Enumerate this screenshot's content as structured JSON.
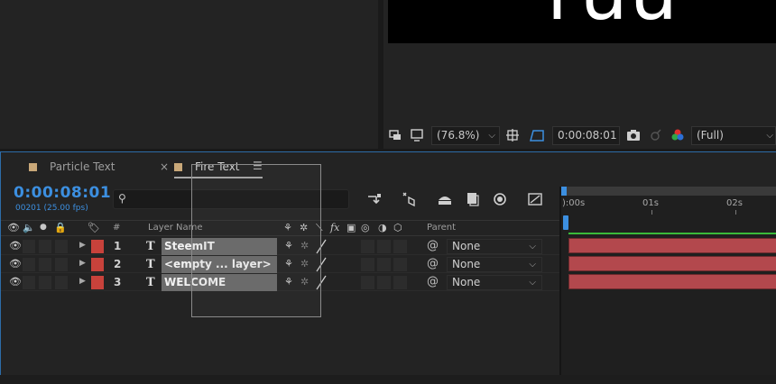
{
  "viewer": {
    "comp_text": "ruu",
    "zoom": "(76.8%)",
    "timecode": "0:00:08:01",
    "resolution": "(Full)",
    "icons": [
      "region-icon",
      "monitor-icon",
      "grid-icon",
      "transparency-grid-icon",
      "snapshot-icon",
      "show-snapshot-icon",
      "channel-icon"
    ]
  },
  "tabs": [
    {
      "label": "Particle Text",
      "active": false
    },
    {
      "label": "Fire Text",
      "active": true
    }
  ],
  "timeline": {
    "timecode": "0:00:08:01",
    "frames_fps": "00201 (25.00 fps)",
    "search_placeholder": "",
    "ruler": [
      "):00s",
      "01s",
      "02s"
    ]
  },
  "columns": {
    "num": "#",
    "layer_name": "Layer Name",
    "parent": "Parent"
  },
  "layers": [
    {
      "num": "1",
      "name": "SteemIT",
      "parent": "None"
    },
    {
      "num": "2",
      "name": "<empty ... layer>",
      "parent": "None"
    },
    {
      "num": "3",
      "name": "WELCOME",
      "parent": "None"
    }
  ],
  "colors": {
    "accent": "#3c8fe0",
    "layer_label": "#c8423b",
    "layer_bar": "#b3484d",
    "tab_swatch": "#c9a879"
  }
}
